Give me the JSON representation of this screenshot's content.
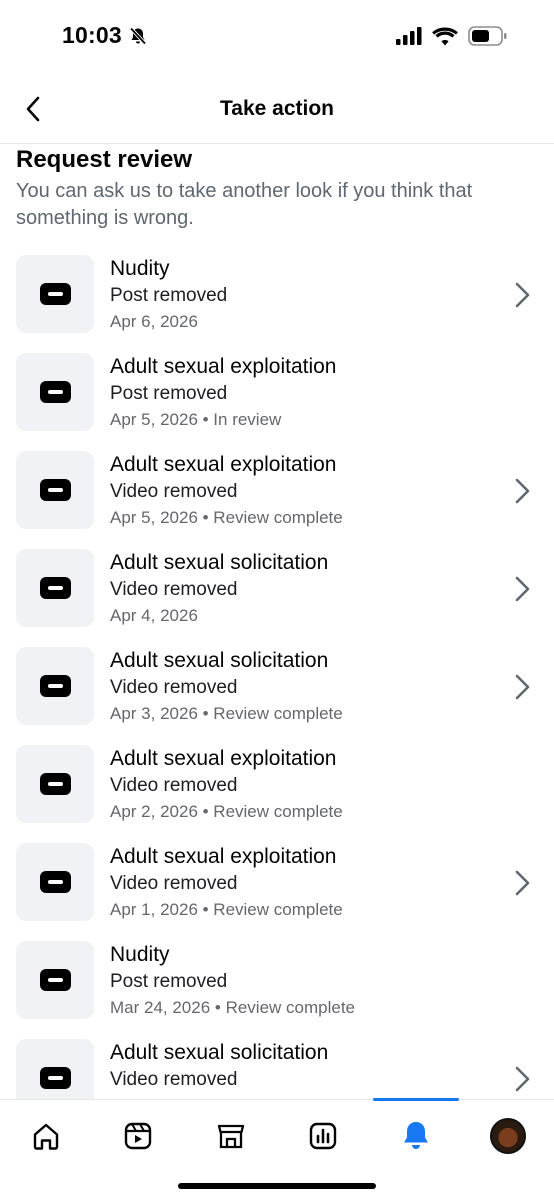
{
  "status_bar": {
    "time": "10:03"
  },
  "header": {
    "title": "Take action"
  },
  "section": {
    "title": "Request review",
    "description": "You can ask us to take another look if you think that something is wrong."
  },
  "items": [
    {
      "title": "Nudity",
      "subtitle": "Post removed",
      "meta": "Apr 6, 2026",
      "has_chevron": true
    },
    {
      "title": "Adult sexual exploitation",
      "subtitle": "Post removed",
      "meta": "Apr 5, 2026 • In review",
      "has_chevron": false
    },
    {
      "title": "Adult sexual exploitation",
      "subtitle": "Video removed",
      "meta": "Apr 5, 2026 • Review complete",
      "has_chevron": true
    },
    {
      "title": "Adult sexual solicitation",
      "subtitle": "Video removed",
      "meta": "Apr 4, 2026",
      "has_chevron": true
    },
    {
      "title": "Adult sexual solicitation",
      "subtitle": "Video removed",
      "meta": "Apr 3, 2026 • Review complete",
      "has_chevron": true
    },
    {
      "title": "Adult sexual exploitation",
      "subtitle": "Video removed",
      "meta": "Apr 2, 2026 • Review complete",
      "has_chevron": false
    },
    {
      "title": "Adult sexual exploitation",
      "subtitle": "Video removed",
      "meta": "Apr 1, 2026 • Review complete",
      "has_chevron": true
    },
    {
      "title": "Nudity",
      "subtitle": "Post removed",
      "meta": "Mar 24, 2026 • Review complete",
      "has_chevron": false
    },
    {
      "title": "Adult sexual solicitation",
      "subtitle": "Video removed",
      "meta": "",
      "has_chevron": true
    }
  ],
  "tabs": [
    {
      "name": "home",
      "icon": "home-icon",
      "active": false
    },
    {
      "name": "reels",
      "icon": "reels-icon",
      "active": false
    },
    {
      "name": "shop",
      "icon": "shop-icon",
      "active": false
    },
    {
      "name": "insights",
      "icon": "insights-icon",
      "active": false
    },
    {
      "name": "notifications",
      "icon": "bell-icon",
      "active": true
    },
    {
      "name": "profile",
      "icon": "avatar",
      "active": false
    }
  ],
  "colors": {
    "accent": "#1877f2",
    "secondary_text": "#65676b",
    "thumb_bg": "#f0f2f5"
  }
}
